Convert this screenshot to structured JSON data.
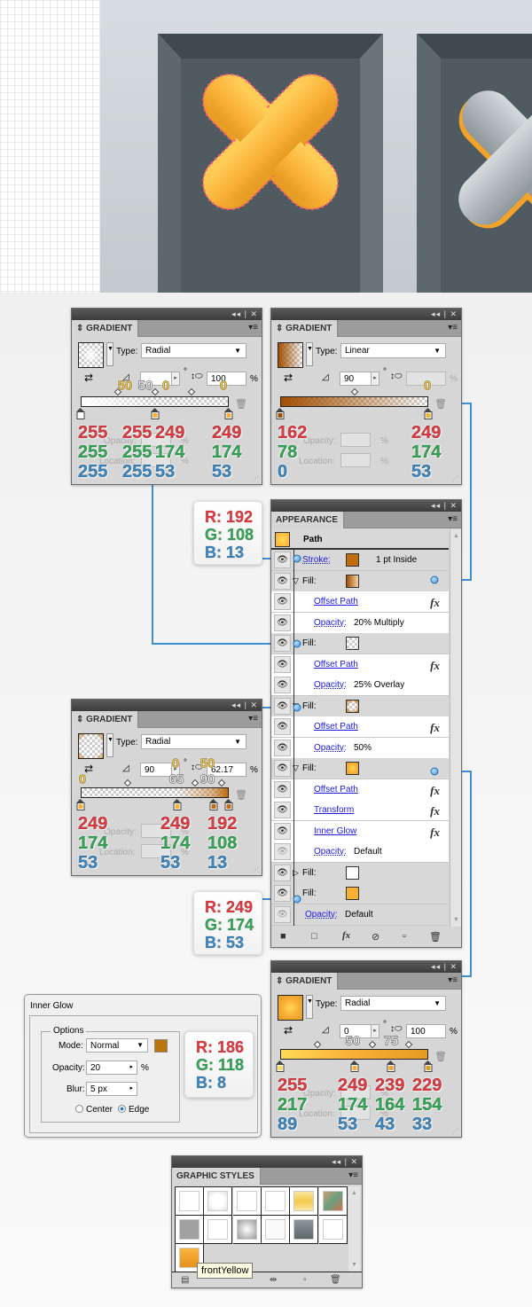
{
  "gradient_panels": [
    {
      "title": "GRADIENT",
      "type_label": "Type:",
      "type": "Radial",
      "angle": "",
      "aspect": "100",
      "aspect_unit": "%",
      "degree": "°",
      "opacity_label": "Opacity:",
      "location_label": "Location:",
      "pct": "%",
      "stops": [
        {
          "color": "#ffffff",
          "opacity": 100,
          "location": 0
        },
        {
          "color": "#f9ae35",
          "opacity": 0,
          "location": 50
        },
        {
          "color": "#f9ae35",
          "opacity": 0,
          "location": 100
        }
      ],
      "midpoints": [
        25,
        50,
        75
      ],
      "annotations": [
        "50",
        "50",
        "0",
        "0"
      ],
      "rgb": [
        {
          "r": "255",
          "g": "255",
          "b": "255"
        },
        {
          "r": "255",
          "g": "255",
          "b": "255"
        },
        {
          "r": "249",
          "g": "174",
          "b": "53"
        },
        {
          "r": "249",
          "g": "174",
          "b": "53"
        }
      ]
    },
    {
      "title": "GRADIENT",
      "type_label": "Type:",
      "type": "Linear",
      "angle": "90",
      "aspect": "",
      "aspect_unit": "%",
      "degree": "°",
      "opacity_label": "Opacity:",
      "location_label": "Location:",
      "pct": "%",
      "stops": [
        {
          "color": "#a24e00",
          "opacity": 100,
          "location": 0
        },
        {
          "color": "#f9ae35",
          "opacity": 0,
          "location": 100
        }
      ],
      "midpoints": [
        50
      ],
      "annotations": [
        "0"
      ],
      "rgb": [
        {
          "r": "162",
          "g": "78",
          "b": "0"
        },
        {
          "r": "249",
          "g": "174",
          "b": "53"
        }
      ]
    },
    {
      "title": "GRADIENT",
      "type_label": "Type:",
      "type": "Radial",
      "angle": "90",
      "aspect": "62.17",
      "aspect_unit": "%",
      "degree": "°",
      "opacity_label": "Opacity:",
      "location_label": "Location:",
      "pct": "%",
      "stops": [
        {
          "color": "#f9ae35",
          "opacity": 0,
          "location": 0
        },
        {
          "color": "#f9ae35",
          "opacity": 0,
          "location": 65
        },
        {
          "color": "#c06c0d",
          "opacity": 50,
          "location": 90
        },
        {
          "color": "#c06c0d",
          "opacity": 100,
          "location": 100
        }
      ],
      "midpoints": [
        32,
        77,
        95
      ],
      "annotations": [
        "0",
        "0",
        "50",
        "65",
        "90"
      ],
      "rgb": [
        {
          "r": "249",
          "g": "174",
          "b": "53"
        },
        {
          "r": "249",
          "g": "174",
          "b": "53"
        },
        {
          "r": "192",
          "g": "108",
          "b": "13"
        }
      ]
    },
    {
      "title": "GRADIENT",
      "type_label": "Type:",
      "type": "Radial",
      "angle": "0",
      "aspect": "100",
      "aspect_unit": "%",
      "degree": "°",
      "opacity_label": "Opacity:",
      "location_label": "Location:",
      "pct": "%",
      "stops": [
        {
          "color": "#ffd959",
          "opacity": 100,
          "location": 0
        },
        {
          "color": "#f9ae35",
          "opacity": 100,
          "location": 50
        },
        {
          "color": "#efa42b",
          "opacity": 100,
          "location": 75
        },
        {
          "color": "#e59a21",
          "opacity": 100,
          "location": 100
        }
      ],
      "midpoints": [
        25,
        62,
        87
      ],
      "annotations": [
        "50",
        "75"
      ],
      "rgb": [
        {
          "r": "255",
          "g": "217",
          "b": "89"
        },
        {
          "r": "249",
          "g": "174",
          "b": "53"
        },
        {
          "r": "239",
          "g": "164",
          "b": "43"
        },
        {
          "r": "229",
          "g": "154",
          "b": "33"
        }
      ]
    }
  ],
  "callouts": [
    {
      "r": "R: 192",
      "g": "G: 108",
      "b": "B: 13"
    },
    {
      "r": "R: 249",
      "g": "G: 174",
      "b": "B: 53"
    },
    {
      "r": "R: 186",
      "g": "G: 118",
      "b": "B: 8"
    }
  ],
  "appearance": {
    "title": "APPEARANCE",
    "header": "Path",
    "rows": [
      {
        "kind": "attr",
        "label": "Stroke:",
        "swatch": "#c06c0d",
        "value": "1 pt  Inside"
      },
      {
        "kind": "attr",
        "label": "Fill:",
        "swatch": "linear-gradient(to right,#a24e00,#f3d4a8)",
        "expanded": true
      },
      {
        "kind": "effect",
        "label": "Offset Path",
        "fx": true
      },
      {
        "kind": "opacity",
        "label": "Opacity:",
        "value": "20% Multiply"
      },
      {
        "kind": "attr",
        "label": "Fill:",
        "swatch": "checker-white"
      },
      {
        "kind": "effect",
        "label": "Offset Path",
        "fx": true
      },
      {
        "kind": "opacity",
        "label": "Opacity:",
        "value": "25% Overlay"
      },
      {
        "kind": "attr",
        "label": "Fill:",
        "swatch": "checker-brown",
        "expanded": true
      },
      {
        "kind": "effect",
        "label": "Offset Path",
        "fx": true
      },
      {
        "kind": "opacity",
        "label": "Opacity:",
        "value": "50%"
      },
      {
        "kind": "attr",
        "label": "Fill:",
        "swatch": "radial-gradient(circle,#ffd959,#f9ae35 60%,#e59a21)",
        "expanded": true
      },
      {
        "kind": "effect",
        "label": "Offset Path",
        "fx": true
      },
      {
        "kind": "effect",
        "label": "Transform",
        "fx": true
      },
      {
        "kind": "effect",
        "label": "Inner Glow",
        "fx": true
      },
      {
        "kind": "opacity",
        "label": "Opacity:",
        "value": "Default",
        "dim": true
      },
      {
        "kind": "attr",
        "label": "Fill:",
        "swatch": "#ffffff",
        "collapsed": true
      },
      {
        "kind": "attr",
        "label": "Fill:",
        "swatch": "#f9ae35"
      },
      {
        "kind": "opacity-root",
        "label": "Opacity:",
        "value": "Default",
        "dim": true
      }
    ]
  },
  "inner_glow": {
    "title": "Inner Glow",
    "group": "Options",
    "mode_label": "Mode:",
    "mode": "Normal",
    "color": "#ba7608",
    "opacity_label": "Opacity:",
    "opacity": "20",
    "pct": "%",
    "blur_label": "Blur:",
    "blur": "5 px",
    "center_label": "Center",
    "edge_label": "Edge",
    "selected": "Edge"
  },
  "graphic_styles": {
    "title": "GRAPHIC STYLES",
    "tooltip": "frontYellow"
  },
  "colors": {
    "accent_line": "#3d8fd6",
    "red": "#e23a40",
    "green": "#33a955",
    "blue": "#3a88c5",
    "orange": "#f9ae35"
  }
}
